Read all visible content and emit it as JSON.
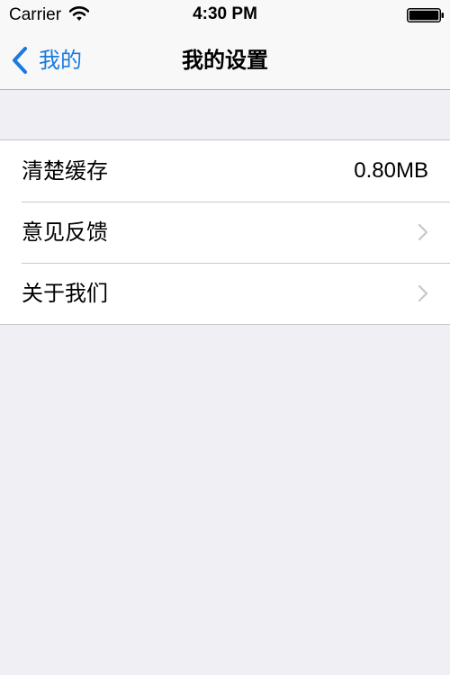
{
  "status_bar": {
    "carrier": "Carrier",
    "time": "4:30 PM",
    "wifi_icon": "wifi-icon",
    "battery_icon": "battery-icon"
  },
  "nav": {
    "back_label": "我的",
    "back_icon": "chevron-left-icon",
    "title": "我的设置"
  },
  "settings": {
    "rows": [
      {
        "label": "清楚缓存",
        "value": "0.80MB"
      },
      {
        "label": "意见反馈",
        "icon": "chevron-right-icon"
      },
      {
        "label": "关于我们",
        "icon": "chevron-right-icon"
      }
    ]
  },
  "colors": {
    "accent": "#1a7ae0",
    "background": "#efeff4",
    "separator": "#c8c7cc",
    "chevron": "#c7c7cc"
  }
}
